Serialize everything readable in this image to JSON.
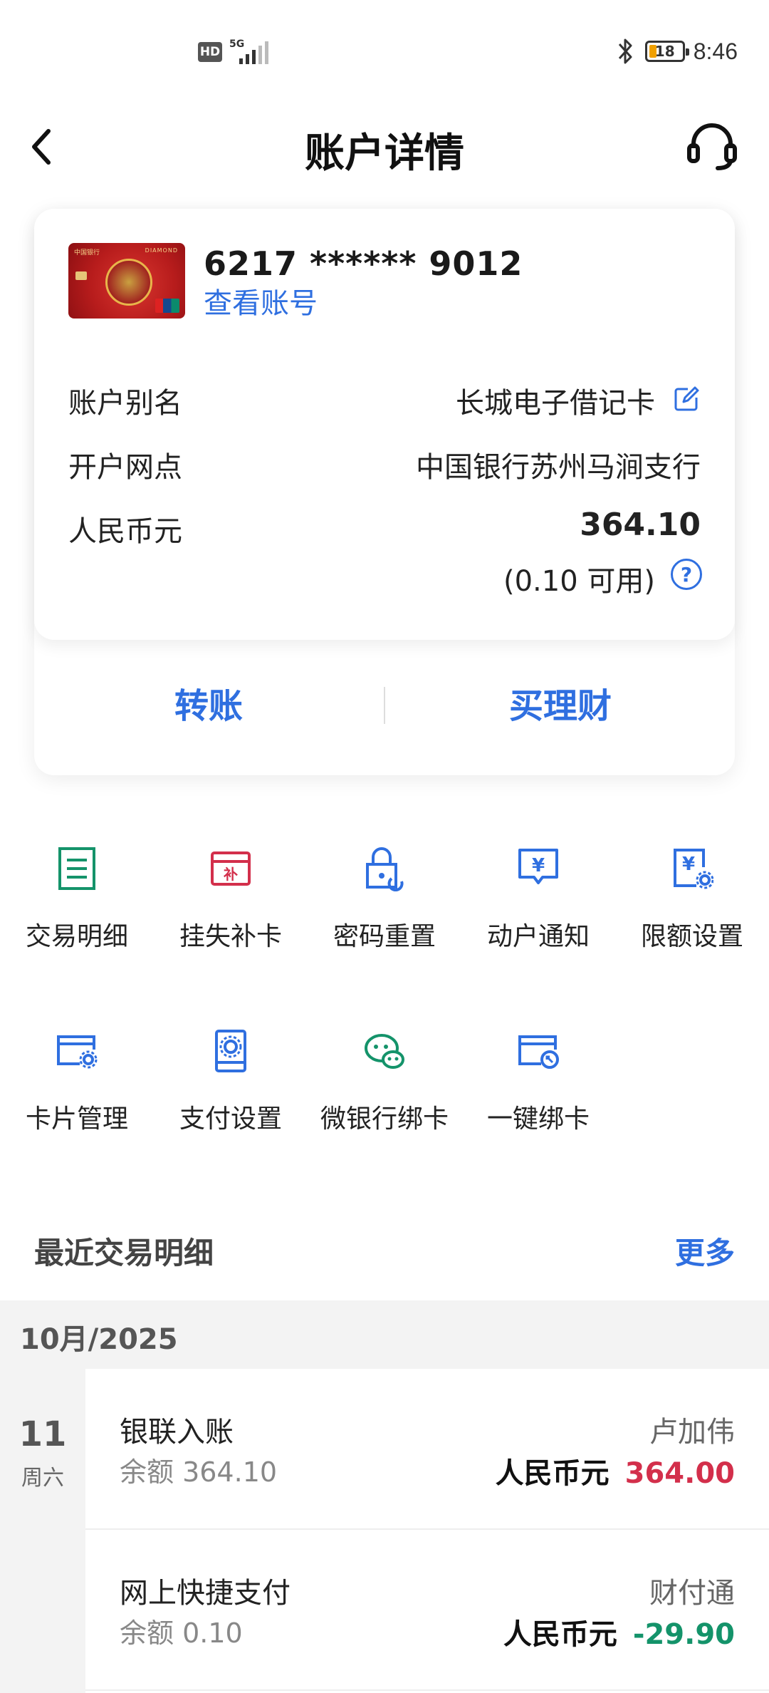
{
  "status_bar": {
    "hd_label": "HD",
    "network_label": "5G",
    "battery_level": "18",
    "time": "8:46"
  },
  "header": {
    "title": "账户详情"
  },
  "account_card": {
    "card_number": "6217 ****** 9012",
    "view_account_label": "查看账号",
    "card_image": {
      "bank_logo_text": "中国银行",
      "edition_text": "DIAMOND"
    },
    "rows": {
      "alias_label": "账户别名",
      "alias_value": "长城电子借记卡",
      "branch_label": "开户网点",
      "branch_value": "中国银行苏州马涧支行",
      "currency_label": "人民币元",
      "balance_value": "364.10",
      "available_text": "(0.10 可用)"
    },
    "actions": {
      "transfer_label": "转账",
      "wealth_label": "买理财"
    }
  },
  "services": [
    {
      "label": "交易明细",
      "icon": "transaction-list-icon",
      "color": "#14936a"
    },
    {
      "label": "挂失补卡",
      "icon": "report-loss-card-icon",
      "color": "#d32f4b"
    },
    {
      "label": "密码重置",
      "icon": "password-reset-icon",
      "color": "#2f6fe0"
    },
    {
      "label": "动户通知",
      "icon": "account-notification-icon",
      "color": "#2f6fe0"
    },
    {
      "label": "限额设置",
      "icon": "limit-settings-icon",
      "color": "#2f6fe0"
    },
    {
      "label": "卡片管理",
      "icon": "card-management-icon",
      "color": "#2f6fe0"
    },
    {
      "label": "支付设置",
      "icon": "payment-settings-icon",
      "color": "#2f6fe0"
    },
    {
      "label": "微银行绑卡",
      "icon": "wechat-bank-bind-icon",
      "color": "#14936a"
    },
    {
      "label": "一键绑卡",
      "icon": "one-click-bind-icon",
      "color": "#2f6fe0"
    }
  ],
  "recent": {
    "title": "最近交易明细",
    "more_label": "更多",
    "month_label": "10月/2025",
    "day_number": "11",
    "day_week": "周六",
    "transactions": [
      {
        "title": "银联入账",
        "balance_text": "余额 364.10",
        "counterparty": "卢加伟",
        "currency": "人民币元",
        "amount": "364.00",
        "direction": "credit"
      },
      {
        "title": "网上快捷支付",
        "balance_text": "余额 0.10",
        "counterparty": "财付通",
        "currency": "人民币元",
        "amount": "-29.90",
        "direction": "debit"
      }
    ]
  },
  "colors": {
    "accent_blue": "#2f6fe0",
    "credit_red": "#d32f4b",
    "debit_green": "#14936a"
  }
}
